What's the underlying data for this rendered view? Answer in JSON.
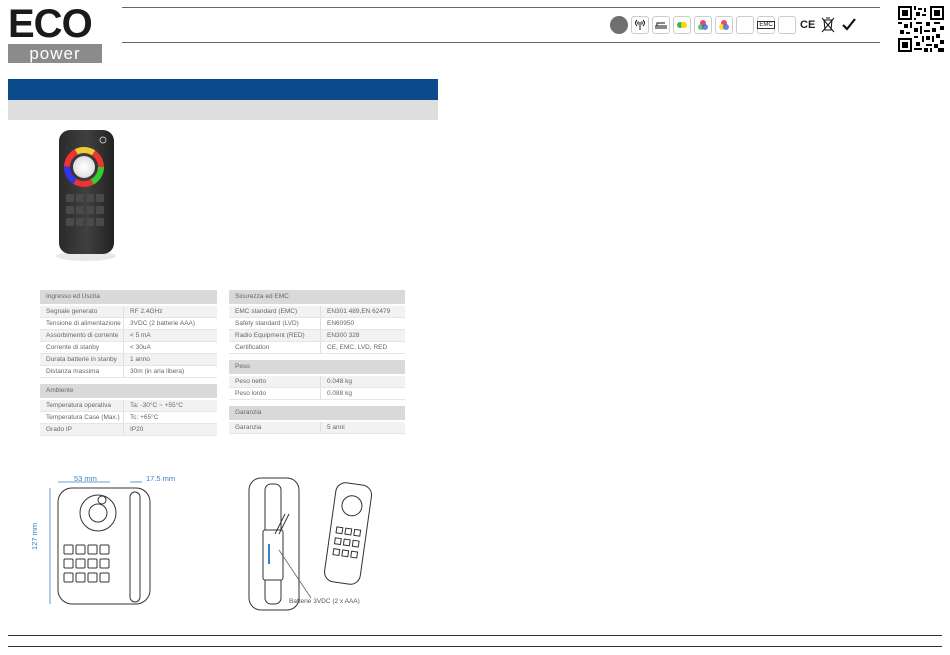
{
  "brand": {
    "eco": "ECO",
    "power": "power"
  },
  "cert_icons": [
    "circle-icon",
    "antenna-icon",
    "wire-icon",
    "color-dot-icon",
    "rgb-icon",
    "rgbw-icon",
    "blank-icon",
    "emc-icon",
    "blank-icon",
    "ce-mark-icon",
    "weee-bin-icon",
    "rohs-icon"
  ],
  "cert_labels": {
    "emc": "EMC",
    "ce": "CE"
  },
  "colors": {
    "title_band": "#0b4b8c",
    "subtitle_band": "#dedede",
    "dimension": "#3a7fc7"
  },
  "spec_left": [
    {
      "section": "Ingresso ed Uscita",
      "rows": [
        {
          "k": "Segnale generato",
          "v": "RF 2.4GHz"
        },
        {
          "k": "Tensione di alimentazione",
          "v": "3VDC (2 batterie AAA)"
        },
        {
          "k": "Assorbimento di corrente",
          "v": "< 5 mA"
        },
        {
          "k": "Corrente di stanby",
          "v": "< 30uA"
        },
        {
          "k": "Durata batterie in stanby",
          "v": "1 anno"
        },
        {
          "k": "Distanza massima",
          "v": "30m (in aria libera)"
        }
      ]
    },
    {
      "section": "Ambiente",
      "rows": [
        {
          "k": "Temperatura operativa",
          "v": "Ta: -30°C ~ +55°C"
        },
        {
          "k": "Temperatura Case (Max.)",
          "v": "Tc: +65°C"
        },
        {
          "k": "Grado IP",
          "v": "IP20"
        }
      ]
    }
  ],
  "spec_right": [
    {
      "section": "Sicurezza ed EMC",
      "rows": [
        {
          "k": "EMC standard (EMC)",
          "v": "EN301 489,EN 62479"
        },
        {
          "k": "Safety standard (LVD)",
          "v": "EN60950"
        },
        {
          "k": "Radio Equipment (RED)",
          "v": "EN300 328"
        },
        {
          "k": "Certification",
          "v": "CE, EMC, LVD, RED"
        }
      ]
    },
    {
      "section": "Peso",
      "rows": [
        {
          "k": "Peso netto",
          "v": "0.048 kg"
        },
        {
          "k": "Peso lordo",
          "v": "0.088 kg"
        }
      ]
    },
    {
      "section": "Garanzia",
      "rows": [
        {
          "k": "Garanzia",
          "v": "5 anni"
        }
      ]
    }
  ],
  "dimensions": {
    "width": "53 mm",
    "depth": "17.5 mm",
    "height": "127 mm"
  },
  "battery_note": "Batterie 3VDC (2 x AAA)"
}
